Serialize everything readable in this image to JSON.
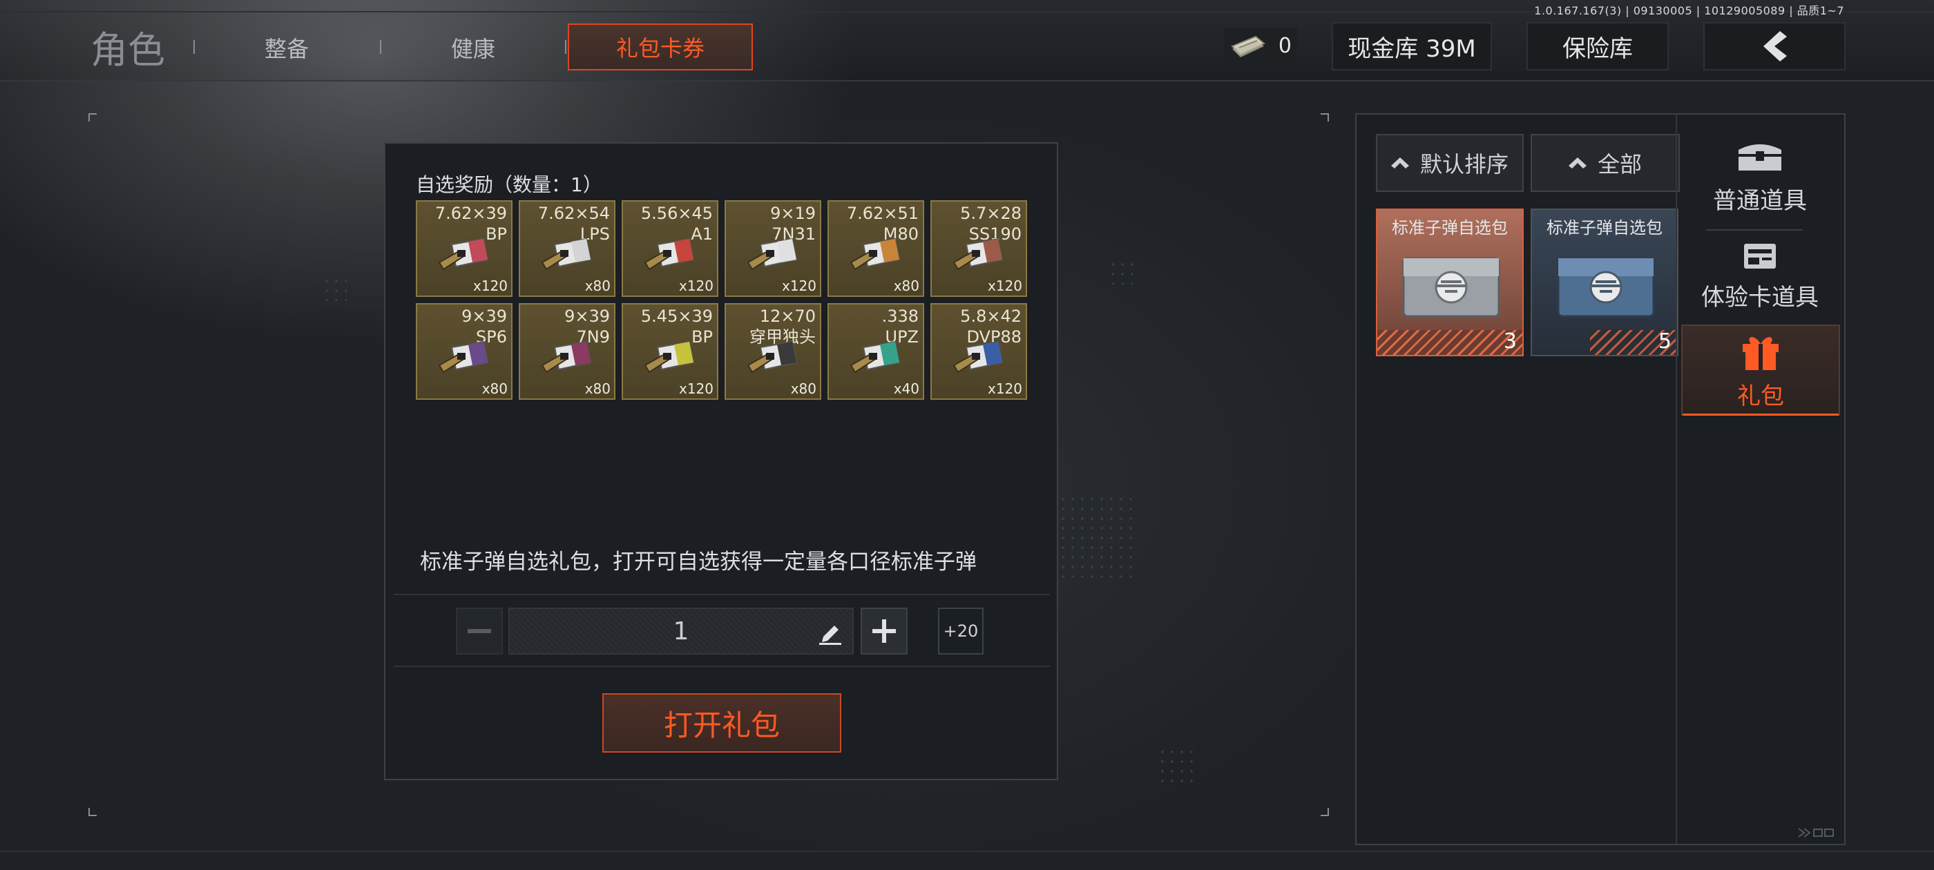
{
  "version": "1.0.167.167(3) | 09130005 | 10129005089 | 品质1~7",
  "tabs": [
    {
      "label": "角色"
    },
    {
      "label": "整备"
    },
    {
      "label": "健康"
    },
    {
      "label": "礼包卡券"
    }
  ],
  "header": {
    "money_value": "0",
    "cash_button": "现金库 39M",
    "vault_button": "保险库"
  },
  "reward_panel": {
    "title": "自选奖励（数量：1）",
    "items": [
      {
        "caliber": "7.62×39\nBP",
        "qty": "x120",
        "color": "#c24b5a"
      },
      {
        "caliber": "7.62×54\nLPS",
        "qty": "x80",
        "color": "#d4d4d4"
      },
      {
        "caliber": "5.56×45\nA1",
        "qty": "x120",
        "color": "#c7453b"
      },
      {
        "caliber": "9×19\n7N31",
        "qty": "x120",
        "color": "#e0e0e0"
      },
      {
        "caliber": "7.62×51\nM80",
        "qty": "x80",
        "color": "#c8853a"
      },
      {
        "caliber": "5.7×28\nSS190",
        "qty": "x120",
        "color": "#9c5b49"
      },
      {
        "caliber": "9×39\nSP6",
        "qty": "x80",
        "color": "#6a4a88"
      },
      {
        "caliber": "9×39\n7N9",
        "qty": "x80",
        "color": "#8b3a62"
      },
      {
        "caliber": "5.45×39\nBP",
        "qty": "x120",
        "color": "#c7c23b"
      },
      {
        "caliber": "12×70\n穿甲独头",
        "qty": "x80",
        "color": "#3a3a3a"
      },
      {
        "caliber": ".338\nUPZ",
        "qty": "x40",
        "color": "#35a38a"
      },
      {
        "caliber": "5.8×42\nDVP88",
        "qty": "x120",
        "color": "#3b5fa6"
      }
    ],
    "description": "标准子弹自选礼包，打开可自选获得一定量各口径标准子弹",
    "quantity_value": "1",
    "plus20_label": "+20",
    "open_button": "打开礼包"
  },
  "inventory": {
    "sort_label": "默认排序",
    "filter_label": "全部",
    "items": [
      {
        "label": "标准子弹自选包",
        "count": "3",
        "tint": "#c07a65"
      },
      {
        "label": "标准子弹自选包",
        "count": "5",
        "tint": "#3c4a5a"
      }
    ],
    "categories": [
      {
        "label": "普通道具",
        "icon": "chest-icon"
      },
      {
        "label": "体验卡道具",
        "icon": "card-icon"
      },
      {
        "label": "礼包",
        "icon": "gift-icon"
      }
    ]
  },
  "colors": {
    "accent": "#ff5a24",
    "panel_bg": "#1b1e22",
    "ammo_tile": "#5e5130"
  }
}
